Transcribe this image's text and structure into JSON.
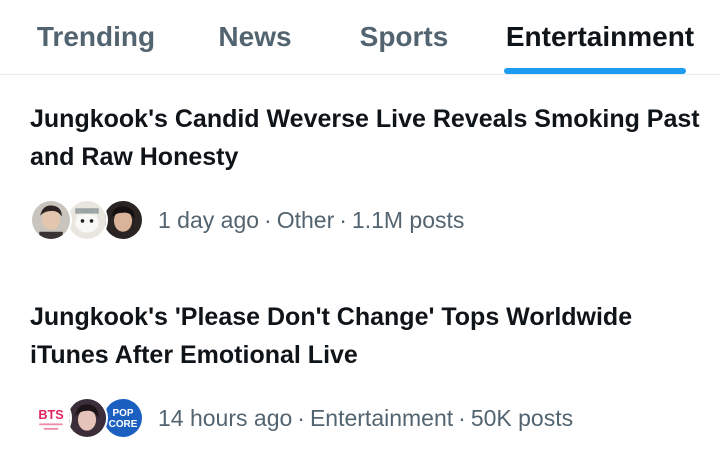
{
  "tabs": [
    {
      "label": "Trending",
      "active": false
    },
    {
      "label": "News",
      "active": false
    },
    {
      "label": "Sports",
      "active": false
    },
    {
      "label": "Entertainment",
      "active": true
    }
  ],
  "colors": {
    "accent": "#1d9bf0",
    "text": "#0f1419",
    "muted": "#536471",
    "divider": "#e6ecf0"
  },
  "stories": [
    {
      "headline": "Jungkook's Candid Weverse Live Reveals Smoking Past and Raw Honesty",
      "time": "1 day ago",
      "category": "Other",
      "posts": "1.1M posts",
      "avatars": [
        "person-photo-icon",
        "cat-meme-icon",
        "person-photo-icon"
      ]
    },
    {
      "headline": "Jungkook's 'Please Don't Change' Tops Worldwide iTunes After Emotional Live",
      "time": "14 hours ago",
      "category": "Entertainment",
      "posts": "50K posts",
      "avatars": [
        "bts-logo-icon",
        "person-photo-icon",
        "popcore-logo-icon"
      ],
      "logo_text": {
        "bts": "BTS",
        "popcore_top": "POP",
        "popcore_bottom": "CORE"
      }
    }
  ]
}
